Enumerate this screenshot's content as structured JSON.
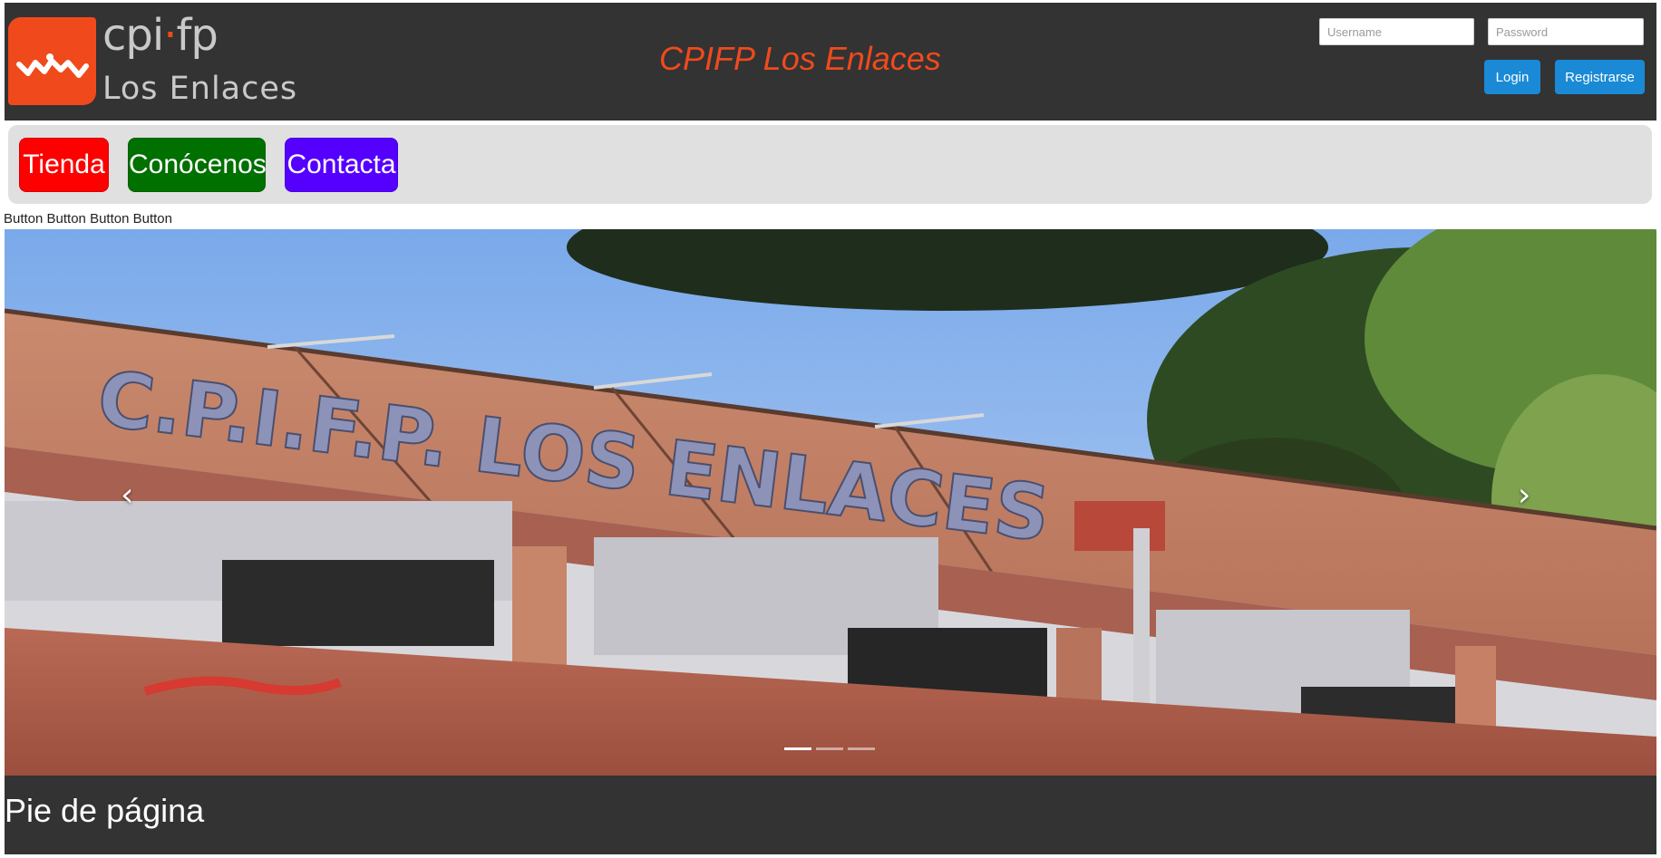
{
  "header": {
    "logo_word_part1": "cpi",
    "logo_word_dot": "·",
    "logo_word_part2": "fp",
    "logo_subtitle": "Los Enlaces",
    "site_title": "CPIFP Los Enlaces",
    "username_placeholder": "Username",
    "password_placeholder": "Password",
    "login_label": "Login",
    "register_label": "Registrarse"
  },
  "nav": {
    "items": [
      {
        "label": "Tienda",
        "color": "#ff0000"
      },
      {
        "label": "Conócenos",
        "color": "#007000"
      },
      {
        "label": "Contacta",
        "color": "#5500ff"
      }
    ],
    "plain_buttons": "Button Button Button Button"
  },
  "carousel": {
    "prev_icon": "chevron-left-icon",
    "next_icon": "chevron-right-icon",
    "prev_glyph": "‹",
    "next_glyph": "›",
    "slide_count": 3,
    "active_slide": 1,
    "sign_text": "C.P.I.F.P. LOS ENLACES"
  },
  "footer": {
    "text": "Pie de página"
  },
  "colors": {
    "header_bg": "#333333",
    "brand_orange": "#f04a1c",
    "button_blue": "#1a8ad6",
    "nav_bg": "#e0e0e0"
  }
}
